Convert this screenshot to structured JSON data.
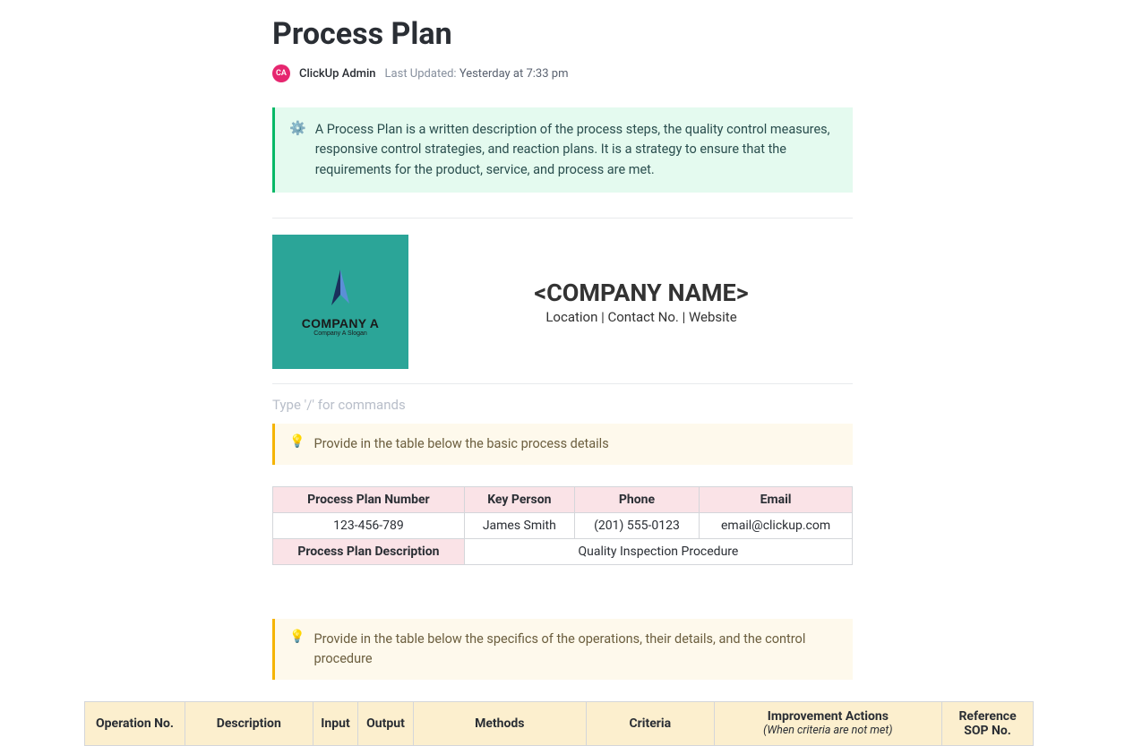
{
  "title": "Process Plan",
  "avatar_initials": "CA",
  "author": "ClickUp Admin",
  "updated_label": "Last Updated:",
  "updated_time": "Yesterday at 7:33 pm",
  "callout1": {
    "icon": "⚙️",
    "text": "A Process Plan is a written description of the process steps, the quality control measures, responsive control strategies, and reaction plans. It is a strategy to ensure that the requirements for the product, service, and process are met."
  },
  "logo": {
    "name": "COMPANY A",
    "slogan": "Company A Slogan"
  },
  "company": {
    "name": "<COMPANY NAME>",
    "sub": "Location | Contact No. | Website"
  },
  "slash_placeholder": "Type '/' for commands",
  "callout2": {
    "icon": "💡",
    "text": "Provide in the table below the basic process details"
  },
  "table1": {
    "headers": {
      "plan_no": "Process Plan Number",
      "key": "Key Person",
      "phone": "Phone",
      "email": "Email"
    },
    "row": {
      "plan_no": "123-456-789",
      "key": "James Smith",
      "phone": "(201) 555-0123",
      "email": "email@clickup.com"
    },
    "desc_header": "Process Plan Description",
    "desc_value": "Quality Inspection Procedure"
  },
  "callout3": {
    "icon": "💡",
    "text": "Provide in the table below the specifics of the operations, their details, and the control procedure"
  },
  "table2": {
    "headers": {
      "op": "Operation No.",
      "desc": "Description",
      "input": "Input",
      "output": "Output",
      "methods": "Methods",
      "criteria": "Criteria",
      "improve": "Improvement Actions",
      "improve_sub": "(When criteria are not met)",
      "ref": "Reference SOP No."
    }
  }
}
